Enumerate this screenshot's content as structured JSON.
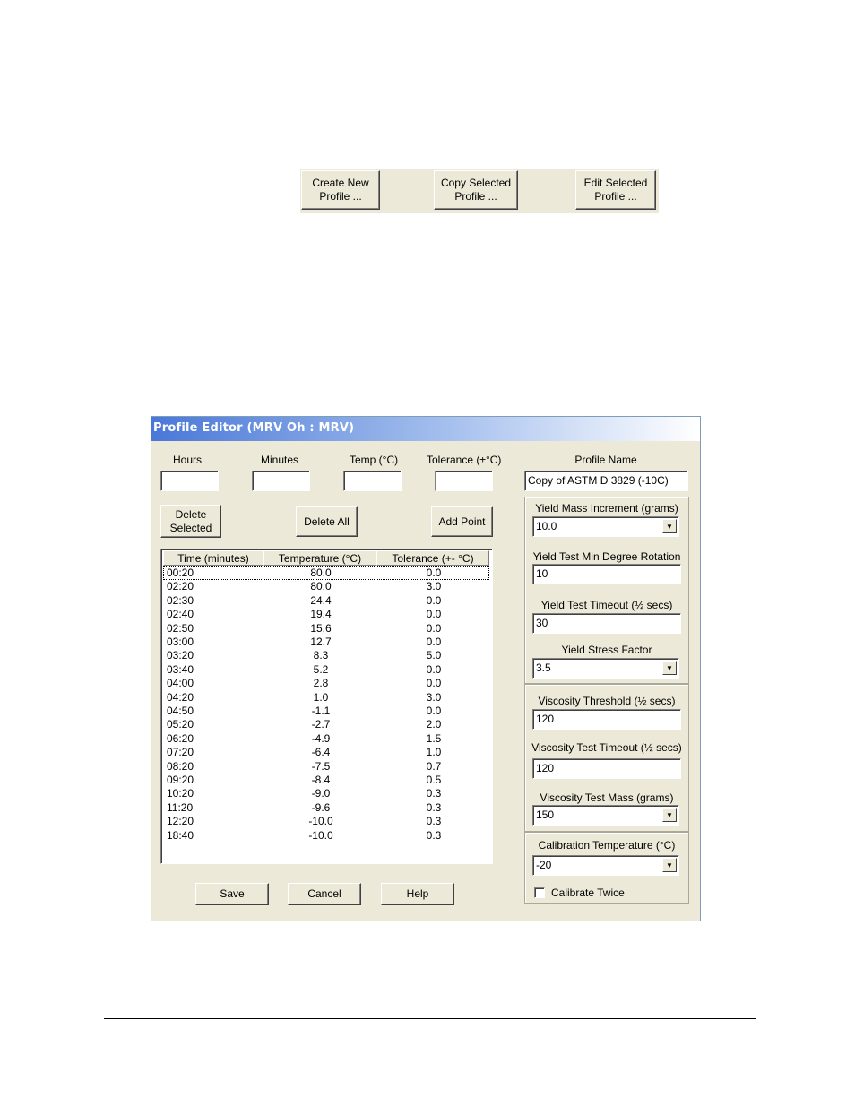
{
  "toolbar": {
    "create_label": "Create New\nProfile ...",
    "copy_label": "Copy Selected\nProfile ...",
    "edit_label": "Edit Selected\nProfile ..."
  },
  "window": {
    "title": "Profile Editor (MRV Oh : MRV)"
  },
  "inputs": {
    "hours_label": "Hours",
    "hours_value": "",
    "minutes_label": "Minutes",
    "minutes_value": "",
    "temp_label": "Temp (°C)",
    "temp_value": "",
    "tolerance_label": "Tolerance (±°C)",
    "tolerance_value": ""
  },
  "actions": {
    "delete_selected": "Delete\nSelected",
    "delete_all": "Delete All",
    "add_point": "Add Point"
  },
  "table": {
    "columns": [
      "Time (minutes)",
      "Temperature (°C)",
      "Tolerance (+- °C)"
    ],
    "rows": [
      [
        "00:20",
        "80.0",
        "0.0"
      ],
      [
        "02:20",
        "80.0",
        "3.0"
      ],
      [
        "02:30",
        "24.4",
        "0.0"
      ],
      [
        "02:40",
        "19.4",
        "0.0"
      ],
      [
        "02:50",
        "15.6",
        "0.0"
      ],
      [
        "03:00",
        "12.7",
        "0.0"
      ],
      [
        "03:20",
        "8.3",
        "5.0"
      ],
      [
        "03:40",
        "5.2",
        "0.0"
      ],
      [
        "04:00",
        "2.8",
        "0.0"
      ],
      [
        "04:20",
        "1.0",
        "3.0"
      ],
      [
        "04:50",
        "-1.1",
        "0.0"
      ],
      [
        "05:20",
        "-2.7",
        "2.0"
      ],
      [
        "06:20",
        "-4.9",
        "1.5"
      ],
      [
        "07:20",
        "-6.4",
        "1.0"
      ],
      [
        "08:20",
        "-7.5",
        "0.7"
      ],
      [
        "09:20",
        "-8.4",
        "0.5"
      ],
      [
        "10:20",
        "-9.0",
        "0.3"
      ],
      [
        "11:20",
        "-9.6",
        "0.3"
      ],
      [
        "12:20",
        "-10.0",
        "0.3"
      ],
      [
        "18:40",
        "-10.0",
        "0.3"
      ]
    ]
  },
  "right": {
    "profile_name_label": "Profile Name",
    "profile_name_value": "Copy of ASTM D 3829 (-10C)",
    "yield_mass_label": "Yield Mass Increment (grams)",
    "yield_mass_value": "10.0",
    "yield_rotation_label": "Yield Test Min Degree Rotation",
    "yield_rotation_value": "10",
    "yield_timeout_label": "Yield Test Timeout (½ secs)",
    "yield_timeout_value": "30",
    "yield_stress_label": "Yield Stress Factor",
    "yield_stress_value": "3.5",
    "visc_threshold_label": "Viscosity Threshold (½ secs)",
    "visc_threshold_value": "120",
    "visc_timeout_label": "Viscosity Test Timeout (½ secs)",
    "visc_timeout_value": "120",
    "visc_mass_label": "Viscosity Test Mass (grams)",
    "visc_mass_value": "150",
    "calib_temp_label": "Calibration Temperature (°C)",
    "calib_temp_value": "-20",
    "calibrate_twice_label": "Calibrate Twice",
    "calibrate_twice_checked": false
  },
  "footer": {
    "save": "Save",
    "cancel": "Cancel",
    "help": "Help"
  }
}
